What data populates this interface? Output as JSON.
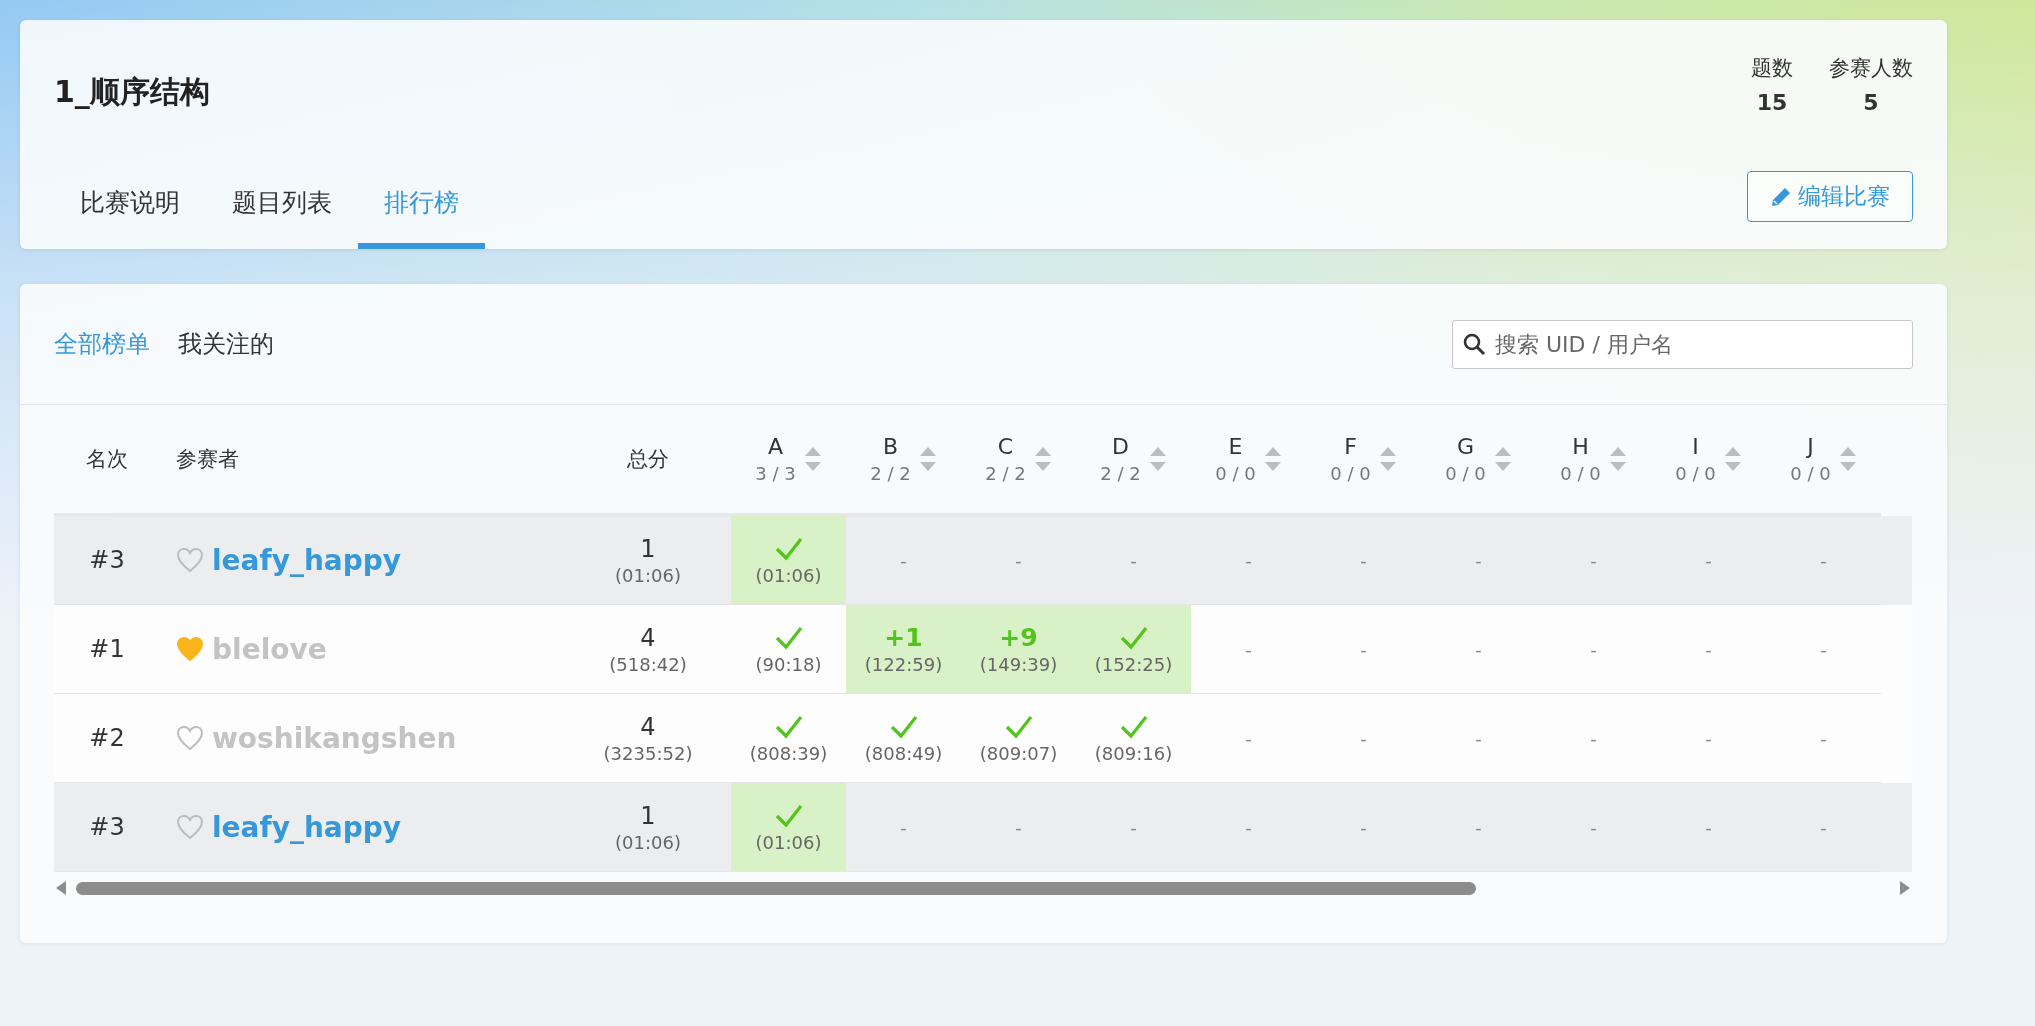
{
  "contest": {
    "title": "1_顺序结构",
    "stats": [
      {
        "label": "题数",
        "value": "15"
      },
      {
        "label": "参赛人数",
        "value": "5"
      }
    ],
    "tabs": [
      {
        "label": "比赛说明",
        "selected": false
      },
      {
        "label": "题目列表",
        "selected": false
      },
      {
        "label": "排行榜",
        "selected": true
      }
    ],
    "edit_button": "编辑比赛"
  },
  "ranking": {
    "filters": [
      {
        "label": "全部榜单",
        "selected": true
      },
      {
        "label": "我关注的",
        "selected": false
      }
    ],
    "search": {
      "placeholder": "搜索 UID / 用户名"
    },
    "table": {
      "columns": {
        "rank": "名次",
        "participant": "参赛者",
        "score": "总分",
        "problems": [
          {
            "label": "A",
            "stats": "3 / 3"
          },
          {
            "label": "B",
            "stats": "2 / 2"
          },
          {
            "label": "C",
            "stats": "2 / 2"
          },
          {
            "label": "D",
            "stats": "2 / 2"
          },
          {
            "label": "E",
            "stats": "0 / 0"
          },
          {
            "label": "F",
            "stats": "0 / 0"
          },
          {
            "label": "G",
            "stats": "0 / 0"
          },
          {
            "label": "H",
            "stats": "0 / 0"
          },
          {
            "label": "I",
            "stats": "0 / 0"
          },
          {
            "label": "J",
            "stats": "0 / 0"
          }
        ]
      },
      "rows": [
        {
          "rank": "#3",
          "name": "leafy_happy",
          "is_me": true,
          "followed": false,
          "highlighted": true,
          "score": "1",
          "penalty": "(01:06)",
          "cells": [
            {
              "kind": "solved",
              "highlighted": true,
              "time": "(01:06)"
            },
            {
              "kind": "empty",
              "text": "-"
            },
            {
              "kind": "empty",
              "text": "-"
            },
            {
              "kind": "empty",
              "text": "-"
            },
            {
              "kind": "empty",
              "text": "-"
            },
            {
              "kind": "empty",
              "text": "-"
            },
            {
              "kind": "empty",
              "text": "-"
            },
            {
              "kind": "empty",
              "text": "-"
            },
            {
              "kind": "empty",
              "text": "-"
            },
            {
              "kind": "empty",
              "text": "-"
            }
          ]
        },
        {
          "rank": "#1",
          "name": "blelove",
          "is_me": false,
          "followed": true,
          "highlighted": false,
          "score": "4",
          "penalty": "(518:42)",
          "cells": [
            {
              "kind": "solved",
              "highlighted": false,
              "time": "(90:18)"
            },
            {
              "kind": "solved",
              "highlighted": true,
              "attempts": "+1",
              "time": "(122:59)"
            },
            {
              "kind": "solved",
              "highlighted": true,
              "attempts": "+9",
              "time": "(149:39)"
            },
            {
              "kind": "solved",
              "highlighted": true,
              "time": "(152:25)"
            },
            {
              "kind": "empty",
              "text": "-"
            },
            {
              "kind": "empty",
              "text": "-"
            },
            {
              "kind": "empty",
              "text": "-"
            },
            {
              "kind": "empty",
              "text": "-"
            },
            {
              "kind": "empty",
              "text": "-"
            },
            {
              "kind": "empty",
              "text": "-"
            }
          ]
        },
        {
          "rank": "#2",
          "name": "woshikangshen",
          "is_me": false,
          "followed": false,
          "highlighted": false,
          "score": "4",
          "penalty": "(3235:52)",
          "cells": [
            {
              "kind": "solved",
              "highlighted": false,
              "time": "(808:39)"
            },
            {
              "kind": "solved",
              "highlighted": false,
              "time": "(808:49)"
            },
            {
              "kind": "solved",
              "highlighted": false,
              "time": "(809:07)"
            },
            {
              "kind": "solved",
              "highlighted": false,
              "time": "(809:16)"
            },
            {
              "kind": "empty",
              "text": "-"
            },
            {
              "kind": "empty",
              "text": "-"
            },
            {
              "kind": "empty",
              "text": "-"
            },
            {
              "kind": "empty",
              "text": "-"
            },
            {
              "kind": "empty",
              "text": "-"
            },
            {
              "kind": "empty",
              "text": "-"
            }
          ]
        },
        {
          "rank": "#3",
          "name": "leafy_happy",
          "is_me": true,
          "followed": false,
          "highlighted": true,
          "score": "1",
          "penalty": "(01:06)",
          "cells": [
            {
              "kind": "solved",
              "highlighted": true,
              "time": "(01:06)"
            },
            {
              "kind": "empty",
              "text": "-"
            },
            {
              "kind": "empty",
              "text": "-"
            },
            {
              "kind": "empty",
              "text": "-"
            },
            {
              "kind": "empty",
              "text": "-"
            },
            {
              "kind": "empty",
              "text": "-"
            },
            {
              "kind": "empty",
              "text": "-"
            },
            {
              "kind": "empty",
              "text": "-"
            },
            {
              "kind": "empty",
              "text": "-"
            },
            {
              "kind": "empty",
              "text": "-"
            }
          ]
        }
      ]
    }
  }
}
